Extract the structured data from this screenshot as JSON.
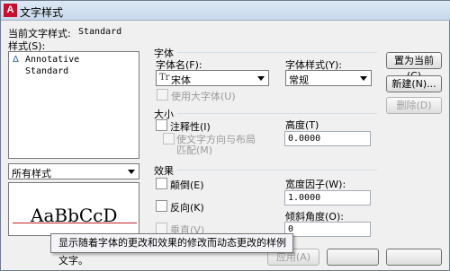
{
  "window": {
    "title": "文字样式",
    "app_icon": "A"
  },
  "current_style": {
    "label": "当前文字样式:",
    "value": "Standard"
  },
  "styles": {
    "label": "样式(S):",
    "items": [
      {
        "icon": "annotative-icon",
        "label": "Annotative"
      },
      {
        "icon": "",
        "label": "Standard"
      }
    ],
    "filter_value": "所有样式"
  },
  "preview": {
    "sample_text": "AaBbCcD"
  },
  "font": {
    "group_label": "字体",
    "name_label": "字体名(F):",
    "name_value": "宋体",
    "name_prefix": "Tr",
    "style_label": "字体样式(Y):",
    "style_value": "常规",
    "big_font_label": "使用大字体(U)"
  },
  "size": {
    "group_label": "大小",
    "annotative_label": "注释性(I)",
    "match_orientation_label_1": "使文字方向与布局",
    "match_orientation_label_2": "匹配(M)",
    "height_label": "高度(T)",
    "height_value": "0.0000"
  },
  "effects": {
    "group_label": "效果",
    "upside_down_label": "颠倒(E)",
    "backwards_label": "反向(K)",
    "vertical_label": "垂直(V)",
    "width_factor_label": "宽度因子(W):",
    "width_factor_value": "1.0000",
    "oblique_label": "倾斜角度(O):",
    "oblique_value": "0"
  },
  "buttons": {
    "set_current": "置为当前(C)",
    "new": "新建(N)...",
    "delete": "删除(D)",
    "apply": "应用(A)"
  },
  "tooltip": "显示随着字体的更改和效果的修改而动态更改的样例文字。"
}
